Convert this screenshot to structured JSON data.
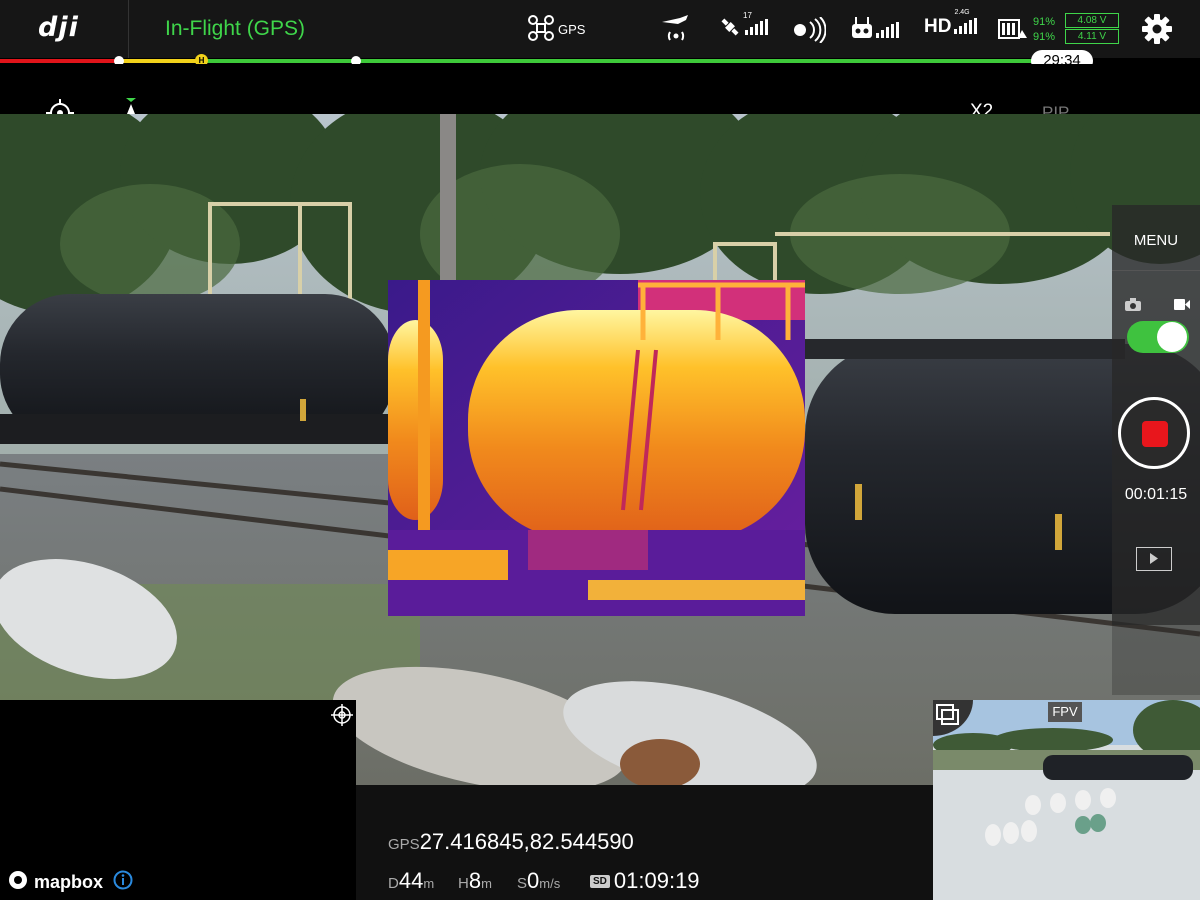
{
  "app": {
    "logo": "dji"
  },
  "topbar": {
    "flight_status": "In-Flight (GPS)",
    "gps_label": "GPS",
    "satellite_count": "17",
    "hd_label": "HD",
    "hd_band": "2.4G",
    "battery_percent_1": "91%",
    "battery_percent_2": "91%",
    "voltage_1": "4.08 V",
    "voltage_2": "4.11 V",
    "home_marker": "H",
    "flight_time": "29:34"
  },
  "camera": {
    "zoom": "X2",
    "pip": "PIP"
  },
  "right_panel": {
    "menu": "MENU",
    "record_time": "00:01:15",
    "video_mode_on": true
  },
  "map": {
    "brand": "mapbox"
  },
  "telemetry": {
    "gps_label": "GPS",
    "coordinates": "27.416845,82.544590",
    "distance_label": "D",
    "distance_value": "44",
    "distance_unit": "m",
    "height_label": "H",
    "height_value": "8",
    "height_unit": "m",
    "speed_label": "S",
    "speed_value": "0",
    "speed_unit": "m/s",
    "sd_label": "SD",
    "sd_remaining": "01:09:19"
  },
  "fpv": {
    "label": "FPV"
  },
  "colors": {
    "accent_green": "#3fd54a",
    "record_red": "#e8161c",
    "progress_red": "#e0141a",
    "progress_yellow": "#f2d21b",
    "progress_green": "#3ec93a"
  },
  "icons": [
    "drone-icon",
    "aircraft-signal-icon",
    "satellite-icon",
    "obstacle-sensor-icon",
    "remote-controller-icon",
    "battery-icon",
    "settings-gear-icon",
    "target-lock-icon",
    "north-arrow-icon",
    "camera-photo-icon",
    "camera-video-icon",
    "playback-icon",
    "recenter-map-icon",
    "info-icon",
    "swap-view-icon"
  ]
}
